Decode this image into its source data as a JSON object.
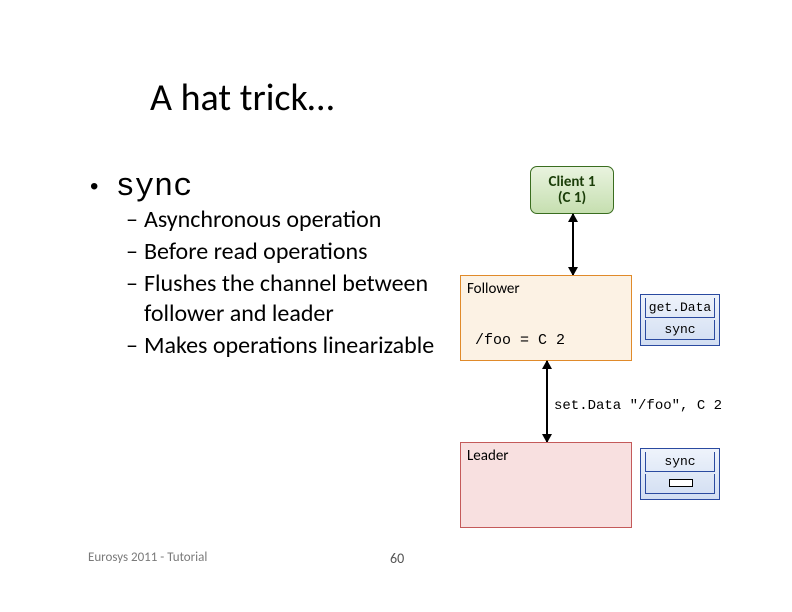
{
  "title": "A hat trick…",
  "main_bullet": "sync",
  "sub_bullets": [
    "Asynchronous operation",
    "Before read operations",
    "Flushes the channel between follower and leader",
    "Makes operations linearizable"
  ],
  "diagram": {
    "client": {
      "line1": "Client 1",
      "line2": "(C 1)"
    },
    "follower": {
      "label": "Follower",
      "state": "/foo = C 2"
    },
    "leader": {
      "label": "Leader"
    },
    "queue_follower": {
      "slot1": "get.Data",
      "slot2": "sync"
    },
    "queue_leader": {
      "slot1": "sync",
      "slot2": ""
    },
    "setdata_label": "set.Data \"/foo\", C 2"
  },
  "footer": "Eurosys 2011 - Tutorial",
  "page_number": "60"
}
